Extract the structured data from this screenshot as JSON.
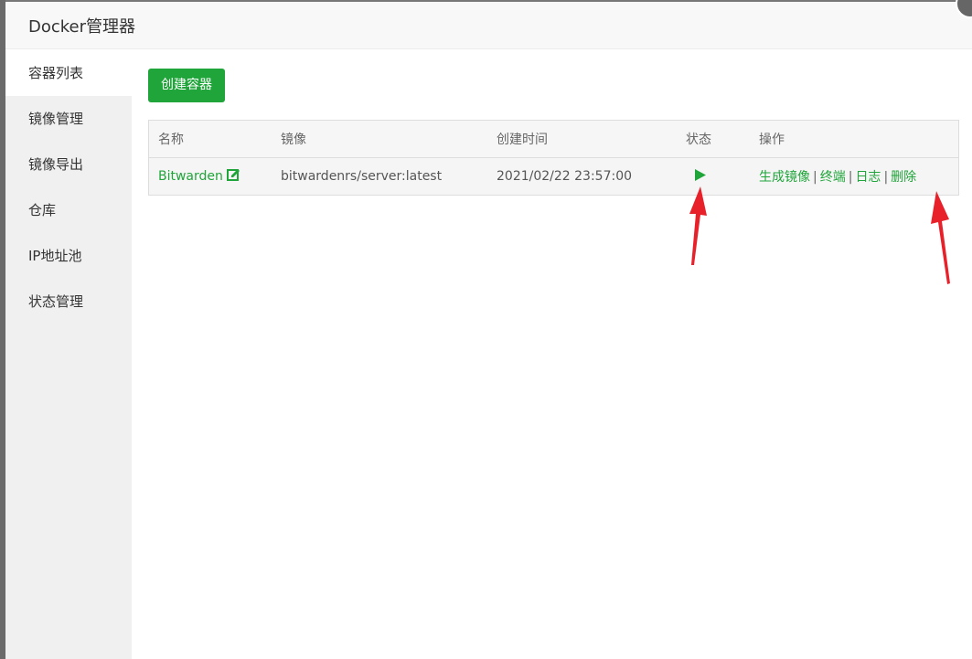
{
  "dialog": {
    "title": "Docker管理器"
  },
  "sidebar": {
    "items": [
      {
        "label": "容器列表",
        "active": true
      },
      {
        "label": "镜像管理"
      },
      {
        "label": "镜像导出"
      },
      {
        "label": "仓库"
      },
      {
        "label": "IP地址池"
      },
      {
        "label": "状态管理"
      }
    ]
  },
  "toolbar": {
    "create_label": "创建容器"
  },
  "table": {
    "headers": {
      "name": "名称",
      "image": "镜像",
      "created": "创建时间",
      "status": "状态",
      "actions": "操作"
    },
    "rows": [
      {
        "name": "Bitwarden",
        "image": "bitwardenrs/server:latest",
        "created": "2021/02/22 23:57:00",
        "status_icon": "play-icon",
        "actions": {
          "generate_image": "生成镜像",
          "terminal": "终端",
          "logs": "日志",
          "delete": "删除",
          "separator": "|"
        }
      }
    ]
  },
  "colors": {
    "accent": "#20a53a",
    "annotation_arrow": "#e8202a"
  }
}
